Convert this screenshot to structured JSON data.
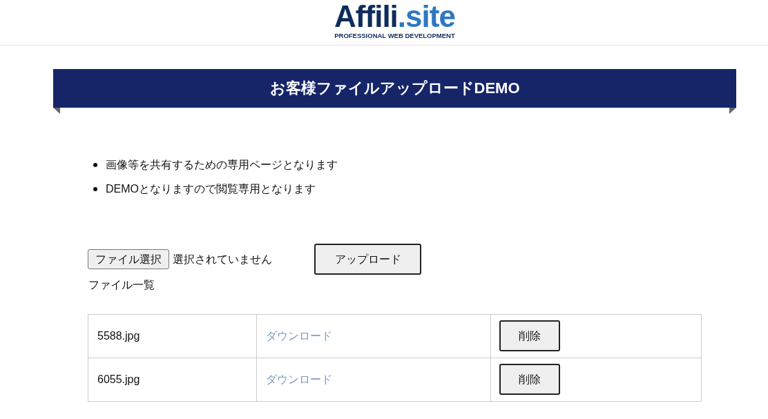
{
  "header": {
    "logo": {
      "main": "Affili",
      "accent": ".site",
      "tagline": "PROFESSIONAL WEB DEVELOPMENT"
    }
  },
  "banner": {
    "title": "お客様ファイルアップロードDEMO"
  },
  "notes": [
    "画像等を共有するための専用ページとなります",
    "DEMOとなりますので閲覧専用となります"
  ],
  "upload": {
    "choose_button": "ファイル選択",
    "file_status": "選択されていません",
    "upload_button": "アップロード"
  },
  "file_list": {
    "heading": "ファイル一覧",
    "rows": [
      {
        "name": "5588.jpg",
        "download": "ダウンロード",
        "delete": "削除"
      },
      {
        "name": "6055.jpg",
        "download": "ダウンロード",
        "delete": "削除"
      }
    ]
  }
}
